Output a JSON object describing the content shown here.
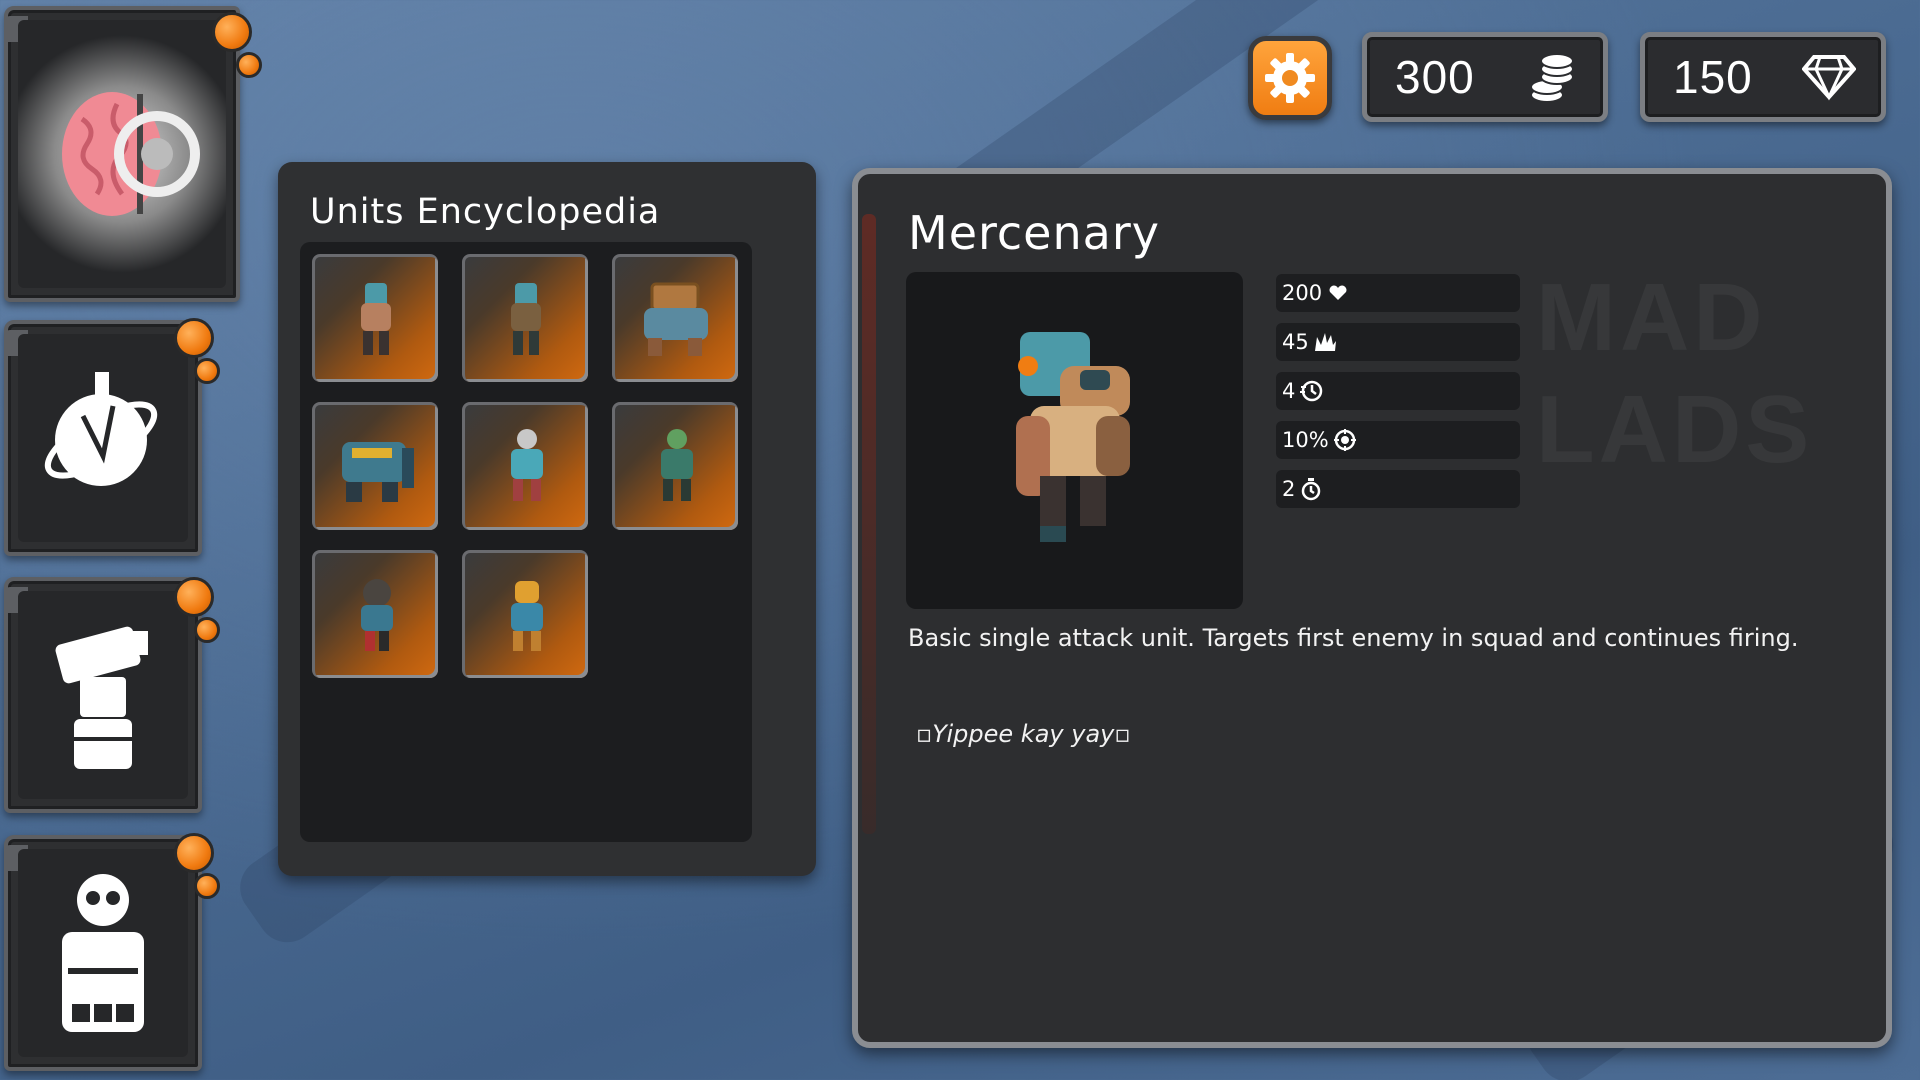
{
  "currency": {
    "coins": "300",
    "gems": "150"
  },
  "nav": {
    "items": [
      {
        "name": "brain"
      },
      {
        "name": "planet"
      },
      {
        "name": "turret"
      },
      {
        "name": "skull-vest"
      }
    ]
  },
  "encyclopedia": {
    "title": "Units Encyclopedia",
    "units": [
      {
        "name": "unit-1"
      },
      {
        "name": "unit-2"
      },
      {
        "name": "unit-3"
      },
      {
        "name": "unit-4"
      },
      {
        "name": "unit-5"
      },
      {
        "name": "unit-6"
      },
      {
        "name": "unit-7"
      },
      {
        "name": "unit-8"
      }
    ]
  },
  "detail": {
    "name": "Mercenary",
    "stats": [
      {
        "value": "200",
        "icon": "heart-icon"
      },
      {
        "value": "45",
        "icon": "damage-icon"
      },
      {
        "value": "4",
        "icon": "attack-speed-icon"
      },
      {
        "value": "10%",
        "icon": "crit-icon"
      },
      {
        "value": "2",
        "icon": "timer-icon"
      }
    ],
    "watermark": [
      "MAD",
      "LADS"
    ],
    "description": "Basic single attack unit. Targets first enemy in squad and continues firing.",
    "quote": "▫Yippee kay yay▫"
  },
  "colors": {
    "accent": "#f07d12",
    "panel": "#2f3032",
    "background": "#4b6b92"
  }
}
